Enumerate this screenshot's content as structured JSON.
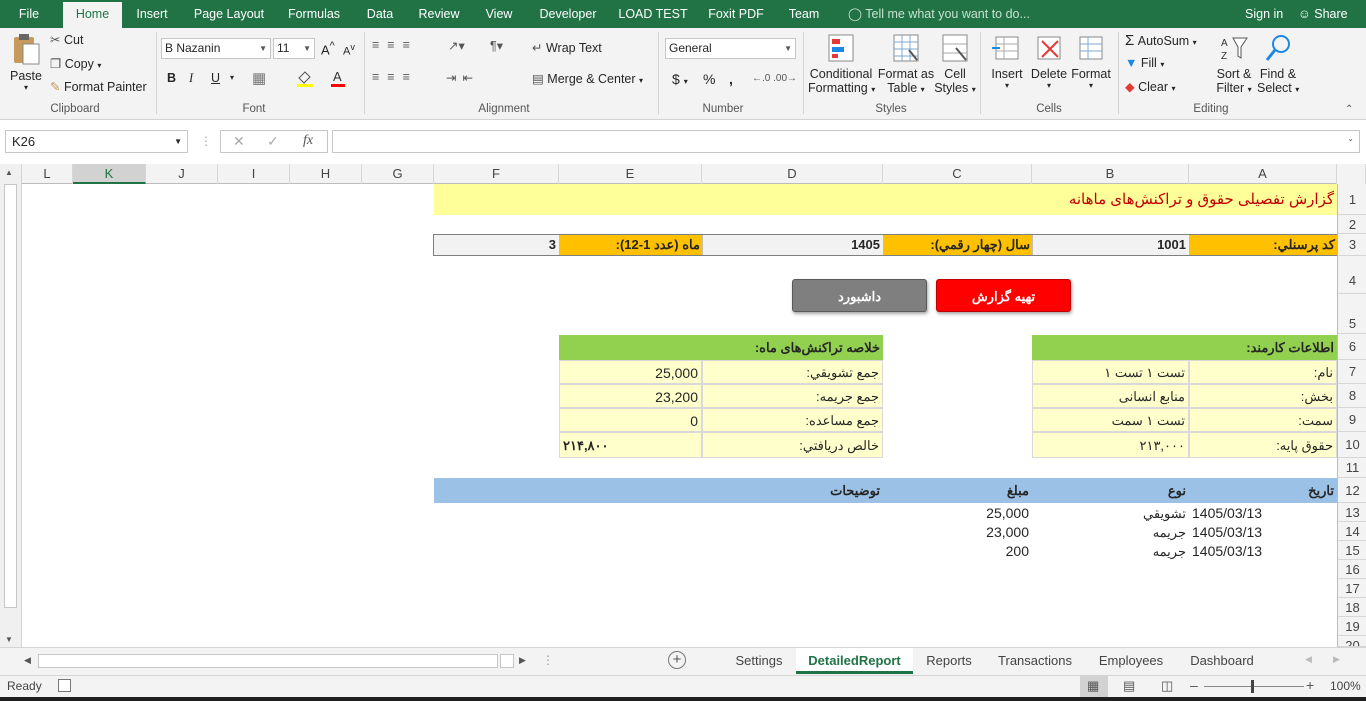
{
  "ribbon_tabs": [
    "File",
    "Home",
    "Insert",
    "Page Layout",
    "Formulas",
    "Data",
    "Review",
    "View",
    "Developer",
    "LOAD TEST",
    "Foxit PDF",
    "Team"
  ],
  "active_tab": "Home",
  "tell_me": "Tell me what you want to do...",
  "sign_in": "Sign in",
  "share": "Share",
  "clipboard": {
    "paste": "Paste",
    "cut": "Cut",
    "copy": "Copy",
    "format_painter": "Format Painter",
    "label": "Clipboard"
  },
  "font": {
    "name": "B Nazanin",
    "size": "11",
    "bold": "B",
    "italic": "I",
    "underline": "U",
    "label": "Font"
  },
  "alignment": {
    "wrap_text": "Wrap Text",
    "merge_center": "Merge & Center",
    "label": "Alignment"
  },
  "number": {
    "format": "General",
    "currency": "$",
    "percent": "%",
    "comma": ",",
    "label": "Number"
  },
  "styles": {
    "conditional": "Conditional",
    "conditional2": "Formatting",
    "format_as": "Format as",
    "format_as2": "Table",
    "cell": "Cell",
    "cell2": "Styles",
    "label": "Styles"
  },
  "cells": {
    "insert": "Insert",
    "delete": "Delete",
    "format": "Format",
    "label": "Cells"
  },
  "editing": {
    "autosum": "AutoSum",
    "fill": "Fill",
    "clear": "Clear",
    "sort": "Sort &",
    "sort2": "Filter",
    "find": "Find &",
    "find2": "Select",
    "label": "Editing"
  },
  "name_box": "K26",
  "fx": "fx",
  "columns": [
    "L",
    "K",
    "J",
    "I",
    "H",
    "G",
    "F",
    "E",
    "D",
    "C",
    "B",
    "A"
  ],
  "rows": [
    "1",
    "2",
    "3",
    "4",
    "5",
    "6",
    "7",
    "8",
    "9",
    "10",
    "11",
    "12",
    "13",
    "14",
    "15",
    "16",
    "17",
    "18",
    "19",
    "20"
  ],
  "sheet": {
    "title": "گزارش تفصیلی حقوق و تراکنش‌های ماهانه",
    "personnel_label": "کد پرسنلي:",
    "personnel_value": "1001",
    "year_label": "سال (چهار رقمي):",
    "year_value": "1405",
    "month_label": "ماه (عدد 1-12):",
    "month_value": "3",
    "btn_report": "تهیه گزارش",
    "btn_dashboard": "داشبورد",
    "emp_header": "اطلاعات کارمند:",
    "emp_rows": [
      {
        "label": "نام:",
        "value": "تست ۱ تست ۱"
      },
      {
        "label": "بخش:",
        "value": "منابع انسانی"
      },
      {
        "label": "سمت:",
        "value": "تست ۱ سمت"
      },
      {
        "label": "حقوق پایه:",
        "value": "۲۱۳,۰۰۰"
      }
    ],
    "sum_header": "خلاصه تراکنش‌های ماه:",
    "sum_rows": [
      {
        "label": "جمع تشویقي:",
        "value": "25,000"
      },
      {
        "label": "جمع جریمه:",
        "value": "23,200"
      },
      {
        "label": "جمع مساعده:",
        "value": "0"
      },
      {
        "label": "خالص دریافتي:",
        "value": "۲۱۴,۸۰۰"
      }
    ],
    "tx_headers": {
      "date": "تاریخ",
      "type": "نوع",
      "amount": "مبلغ",
      "desc": "توضیحات"
    },
    "transactions": [
      {
        "date": "1405/03/13",
        "type": "تشویقي",
        "amount": "25,000"
      },
      {
        "date": "1405/03/13",
        "type": "جریمه",
        "amount": "23,000"
      },
      {
        "date": "1405/03/13",
        "type": "جریمه",
        "amount": "200"
      }
    ]
  },
  "sheet_tabs": [
    "Settings",
    "DetailedReport",
    "Reports",
    "Transactions",
    "Employees",
    "Dashboard"
  ],
  "active_sheet": "DetailedReport",
  "status": "Ready",
  "zoom": "100%",
  "colors": {
    "excel_green": "#217346",
    "yellow": "#ffff99",
    "orange": "#ffc000",
    "green": "#92d050",
    "blue": "#9bc2e6",
    "red": "#ff0000",
    "gray": "#7f7f7f"
  }
}
